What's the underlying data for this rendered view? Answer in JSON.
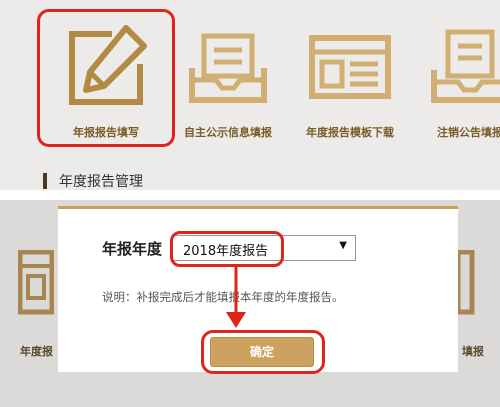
{
  "tiles": [
    {
      "label": "年报报告填写",
      "icon": "pencil-edit-icon"
    },
    {
      "label": "自主公示信息填报",
      "icon": "inbox-tray-icon"
    },
    {
      "label": "年度报告模板下载",
      "icon": "browser-template-icon"
    },
    {
      "label": "注销公告填报",
      "icon": "document-tray-icon"
    }
  ],
  "section": {
    "title": "年度报告管理"
  },
  "background": {
    "left_label": "年度报",
    "right_label": "填报"
  },
  "dialog": {
    "year_label": "年报年度",
    "selected_year": "2018年度报告",
    "dropdown_arrow": "▼",
    "note": "说明：补报完成后才能填报本年度的年度报告。",
    "confirm_label": "确定"
  },
  "colors": {
    "accent_gold": "#c9a25a",
    "highlight_red": "#e0231b",
    "button_gold": "#cda15e"
  }
}
